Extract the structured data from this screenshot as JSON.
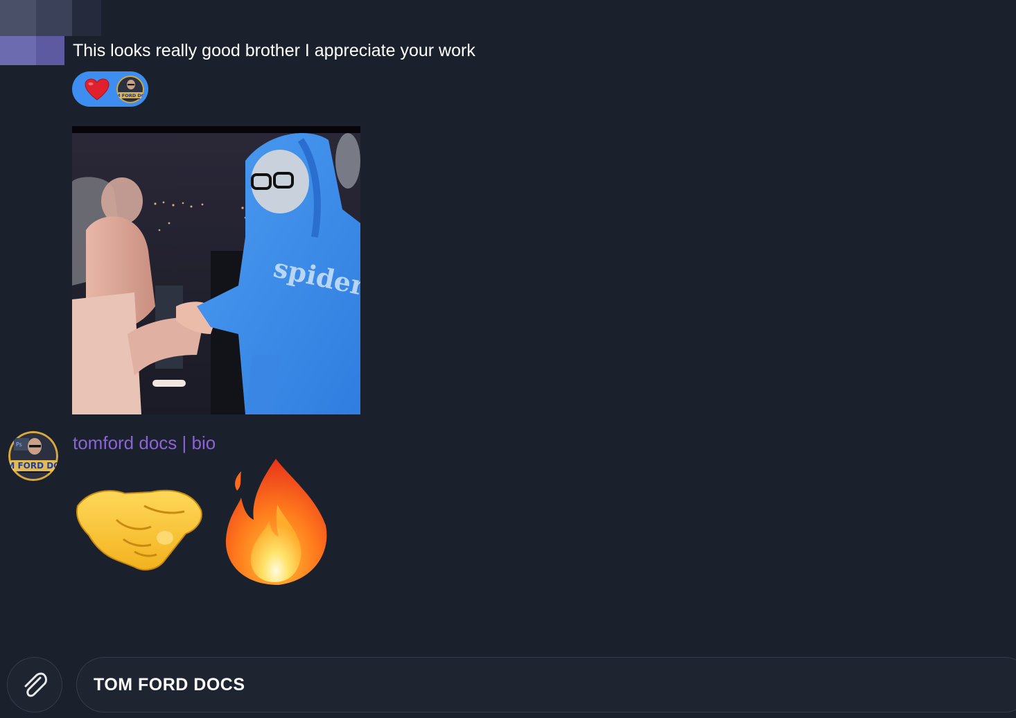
{
  "messages": {
    "first": {
      "text": "This looks really good brother I appreciate your work",
      "reaction": {
        "emoji_icon": "red-heart-icon",
        "reactor_avatar_text": "TOM FORD DOCS"
      }
    },
    "video": {
      "hoodie_text": "spider"
    },
    "second": {
      "sender_name": "tomford docs | bio",
      "sender_avatar_text": "TOM FORD DOCS",
      "emojis": [
        "handshake-icon",
        "fire-icon"
      ]
    }
  },
  "composer": {
    "attach_icon": "paperclip-icon",
    "input_value": "TOM FORD DOCS"
  },
  "colors": {
    "background": "#1b212c",
    "reaction_pill": "#3d8ef0",
    "sender_name": "#8a63d6",
    "border": "#343d4c"
  }
}
